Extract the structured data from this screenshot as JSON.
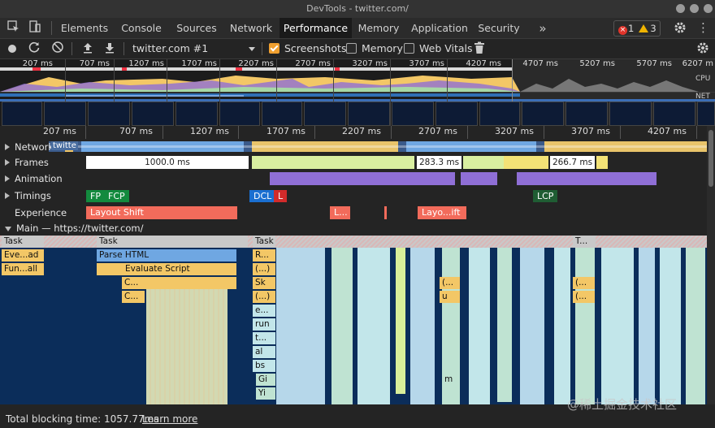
{
  "window": {
    "title": "DevTools - twitter.com/"
  },
  "tabs": [
    "Elements",
    "Console",
    "Sources",
    "Network",
    "Performance",
    "Memory",
    "Application",
    "Security"
  ],
  "active_tab": "Performance",
  "badges": {
    "errors": "1",
    "warnings": "3"
  },
  "toolbar": {
    "profile_select": "twitter.com #1",
    "screenshots_label": "Screenshots",
    "screenshots_checked": true,
    "memory_label": "Memory",
    "memory_checked": false,
    "webvitals_label": "Web Vitals",
    "webvitals_checked": false
  },
  "overview": {
    "ticks": [
      "207 ms",
      "707 ms",
      "1207 ms",
      "1707 ms",
      "2207 ms",
      "2707 ms",
      "3207 ms",
      "3707 ms",
      "4207 ms",
      "4707 ms",
      "5207 ms",
      "5707 ms",
      "6207 m"
    ],
    "cpu_label": "CPU",
    "net_label": "NET"
  },
  "ruler": {
    "ticks": [
      "207 ms",
      "707 ms",
      "1207 ms",
      "1707 ms",
      "2207 ms",
      "2707 ms",
      "3207 ms",
      "3707 ms",
      "4207 ms"
    ]
  },
  "tracks": {
    "network": "Network",
    "network_tag": "twitte",
    "frames": "Frames",
    "frame_values": [
      "1000.0 ms",
      "283.3 ms",
      "266.7 ms"
    ],
    "animation": "Animation",
    "timings": "Timings",
    "timing_markers": [
      "FP",
      "FCP",
      "DCL",
      "L",
      "LCP"
    ],
    "experience": "Experience",
    "experience_items": [
      "Layout Shift",
      "L...",
      "Layo...ift"
    ],
    "main": "Main — https://twitter.com/"
  },
  "flame": {
    "task1": "Task",
    "task1_children": [
      "Eve...ad",
      "Fun...all"
    ],
    "task2": "Task",
    "parse_html": "Parse HTML",
    "evaluate_script": "Evaluate Script",
    "c1": "C...",
    "c2": "C...",
    "task3": "Task",
    "task3_children": [
      "R...",
      "(...)",
      "Sk",
      "(...)",
      "e...",
      "run",
      "t...",
      "al",
      "bs",
      "Gi",
      "Yi"
    ],
    "col_a": [
      "(...",
      "u",
      "m"
    ],
    "task4": "T...",
    "col_b": [
      "(...",
      "(..."
    ]
  },
  "status": {
    "tbt": "Total blocking time: 1057.77ms",
    "learn_more": "Learn more"
  },
  "watermark": "@稀土掘金技术社区",
  "colors": {
    "tab_active_bg": "#1a1a1a",
    "task_grey": "#c9c9c9",
    "parse_html": "#6fa7e2",
    "script_yellow": "#f3c766",
    "paint_green": "#a6d8a6",
    "animation_purple": "#8f6fd6",
    "layout_shift_red": "#f26b5b",
    "fp_green": "#138a3e",
    "dcl_blue": "#1a6fd1",
    "load_red": "#d22b2b",
    "lcp_dark": "#1f5d33",
    "flame_bg": "#0b2d5a"
  }
}
